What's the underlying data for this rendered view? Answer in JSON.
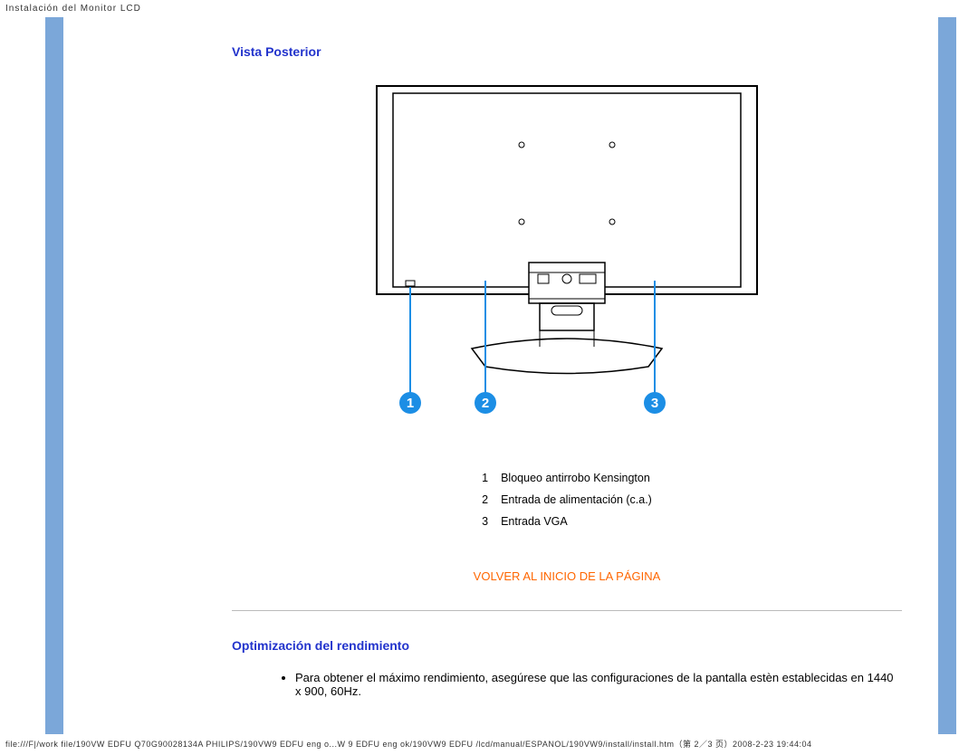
{
  "header": "Instalación del Monitor LCD",
  "section1_title": "Vista Posterior",
  "legend": [
    {
      "num": "1",
      "text": "Bloqueo antirrobo Kensington"
    },
    {
      "num": "2",
      "text": "Entrada de alimentación (c.a.)"
    },
    {
      "num": "3",
      "text": "Entrada VGA"
    }
  ],
  "return_link": "VOLVER AL INICIO DE LA PÁGINA",
  "section2_title": "Optimización del rendimiento",
  "note": "Para obtener el máximo rendimiento, asegúrese que las configuraciones de la pantalla estèn establecidas en 1440 x 900, 60Hz.",
  "footer": "file:///F|/work file/190VW EDFU Q70G90028134A PHILIPS/190VW9 EDFU eng o...W 9 EDFU eng ok/190VW9 EDFU /lcd/manual/ESPANOL/190VW9/install/install.htm（第 2／3 页）2008-2-23 19:44:04"
}
